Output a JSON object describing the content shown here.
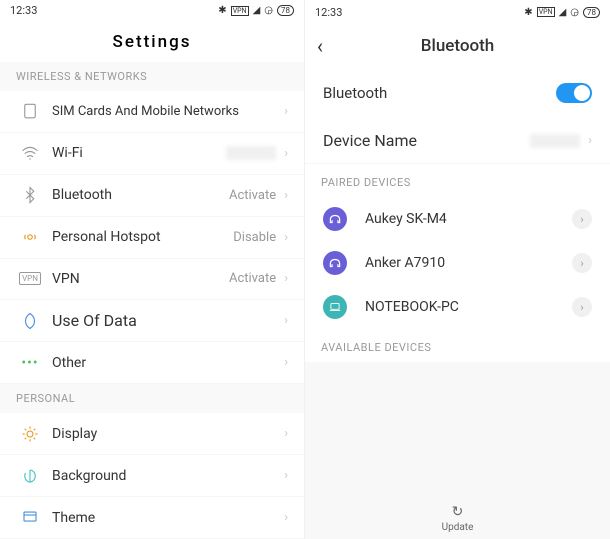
{
  "status": {
    "time": "12:33",
    "battery": "78"
  },
  "left": {
    "title": "Settings",
    "sections": {
      "wireless_header": "WIRELESS & NETWORKS",
      "personal_header": "PERSONAL"
    },
    "items": {
      "sim": {
        "label": "SIM Cards And Mobile Networks"
      },
      "wifi": {
        "label": "Wi-Fi"
      },
      "bluetooth": {
        "label": "Bluetooth",
        "value": "Activate"
      },
      "hotspot": {
        "label": "Personal Hotspot",
        "value": "Disable"
      },
      "vpn": {
        "label": "VPN",
        "value": "Activate"
      },
      "data": {
        "label": "Use Of Data"
      },
      "other": {
        "label": "Other"
      },
      "display": {
        "label": "Display"
      },
      "background": {
        "label": "Background"
      },
      "theme": {
        "label": "Theme"
      }
    }
  },
  "right": {
    "title": "Bluetooth",
    "toggle_label": "Bluetooth",
    "device_name_label": "Device Name",
    "paired_header": "PAIRED DEVICES",
    "available_header": "AVAILABLE DEVICES",
    "devices": {
      "d1": "Aukey SK-M4",
      "d2": "Anker A7910",
      "d3": "NOTEBOOK-PC"
    },
    "update_label": "Update"
  }
}
